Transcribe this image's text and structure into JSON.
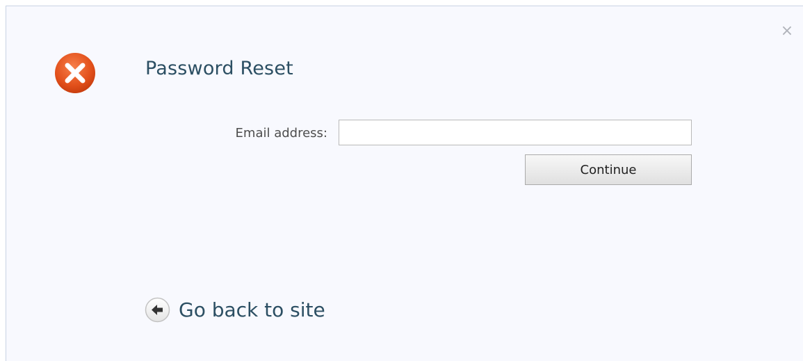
{
  "dialog": {
    "title": "Password Reset",
    "close_icon": "close-icon",
    "status_icon": "error-icon",
    "status_color": "#e2501b"
  },
  "form": {
    "email_label": "Email address:",
    "email_value": "",
    "email_placeholder": "",
    "continue_label": "Continue"
  },
  "footer": {
    "back_label": "Go back to site",
    "back_icon": "arrow-left-icon"
  },
  "colors": {
    "background": "#f8f9fe",
    "title_text": "#2c4f63",
    "link_text": "#2c4f63",
    "error_orange": "#e2501b"
  }
}
